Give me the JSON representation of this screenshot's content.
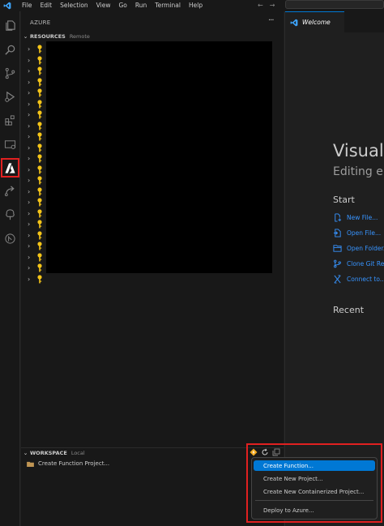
{
  "menubar": {
    "items": [
      "File",
      "Edit",
      "Selection",
      "View",
      "Go",
      "Run",
      "Terminal",
      "Help"
    ],
    "back_arrow": "←",
    "forward_arrow": "→"
  },
  "activity_bar": {
    "icons": [
      "explorer-icon",
      "search-icon",
      "source-control-icon",
      "run-debug-icon",
      "extensions-icon",
      "remote-explorer-icon",
      "azure-icon",
      "deploy-icon",
      "tree-icon",
      "git-graph-icon"
    ],
    "selected": "azure-icon"
  },
  "sidebar": {
    "title": "AZURE",
    "more": "···",
    "resources": {
      "chevron": "⌄",
      "title": "RESOURCES",
      "description": "Remote",
      "row_count": 22,
      "row_chevron": "›",
      "row_icon": "key-icon"
    },
    "workspace": {
      "chevron": "⌄",
      "title": "WORKSPACE",
      "description": "Local",
      "item_label": "Create Function Project..."
    }
  },
  "editor": {
    "tab_label": "Welcome",
    "welcome_title": "Visual",
    "welcome_subtitle": "Editing e",
    "start_heading": "Start",
    "start_links": [
      {
        "label": "New File...",
        "icon": "new-file-icon"
      },
      {
        "label": "Open File...",
        "icon": "open-file-icon"
      },
      {
        "label": "Open Folder...",
        "icon": "open-folder-icon"
      },
      {
        "label": "Clone Git Re",
        "icon": "clone-git-icon"
      },
      {
        "label": "Connect to...",
        "icon": "connect-remote-icon"
      }
    ],
    "recent_heading": "Recent"
  },
  "context_menu": {
    "items": [
      {
        "label": "Create Function...",
        "active": true
      },
      {
        "label": "Create New Project...",
        "active": false
      },
      {
        "label": "Create New Containerized Project...",
        "active": false
      },
      {
        "label": "Deploy to Azure...",
        "active": false
      }
    ]
  },
  "colors": {
    "accent": "#0078d4",
    "link": "#3794ff",
    "highlight": "#e02020",
    "key": "#f5c518"
  }
}
